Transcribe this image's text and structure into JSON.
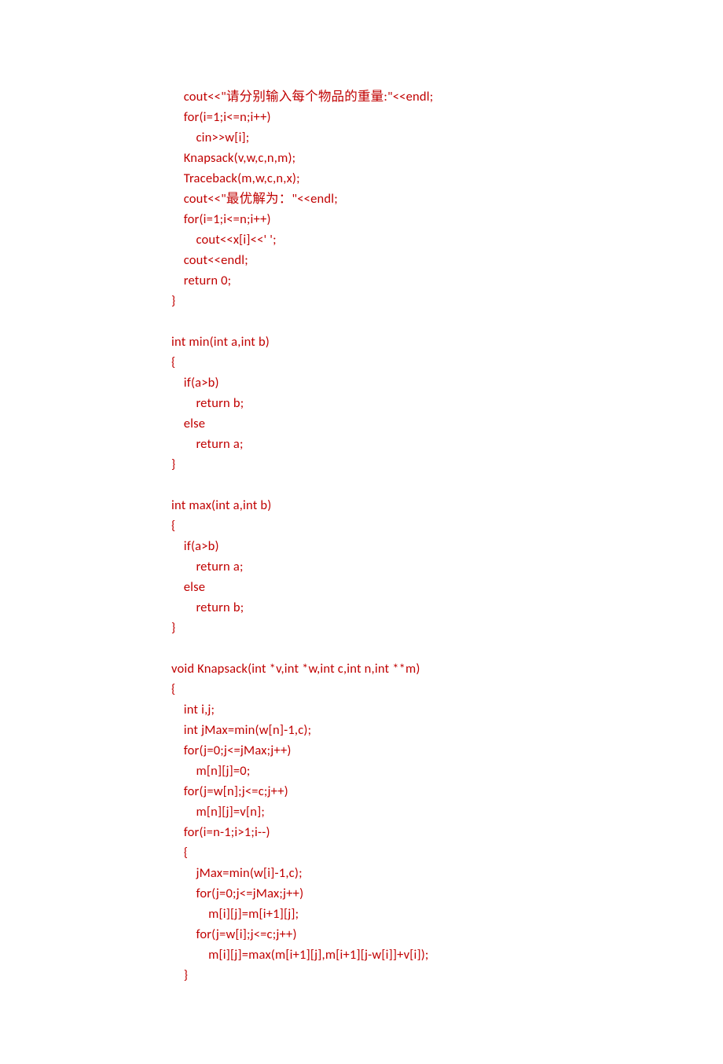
{
  "code": {
    "lines": [
      "    cout<<\"请分别输入每个物品的重量:\"<<endl;",
      "    for(i=1;i<=n;i++)",
      "        cin>>w[i];",
      "    Knapsack(v,w,c,n,m);",
      "    Traceback(m,w,c,n,x);",
      "    cout<<\"最优解为：\"<<endl;",
      "    for(i=1;i<=n;i++)",
      "        cout<<x[i]<<' ';",
      "    cout<<endl;",
      "    return 0;",
      "}",
      "",
      "int min(int a,int b)",
      "{",
      "    if(a>b)",
      "        return b;",
      "    else",
      "        return a;",
      "}",
      "",
      "int max(int a,int b)",
      "{",
      "    if(a>b)",
      "        return a;",
      "    else",
      "        return b;",
      "}",
      "",
      "void Knapsack(int *v,int *w,int c,int n,int **m)",
      "{",
      "    int i,j;",
      "    int jMax=min(w[n]-1,c);",
      "    for(j=0;j<=jMax;j++)",
      "        m[n][j]=0;",
      "    for(j=w[n];j<=c;j++)",
      "        m[n][j]=v[n];",
      "    for(i=n-1;i>1;i--)",
      "    {",
      "        jMax=min(w[i]-1,c);",
      "        for(j=0;j<=jMax;j++)",
      "            m[i][j]=m[i+1][j];",
      "        for(j=w[i];j<=c;j++)",
      "            m[i][j]=max(m[i+1][j],m[i+1][j-w[i]]+v[i]);",
      "    }"
    ]
  }
}
